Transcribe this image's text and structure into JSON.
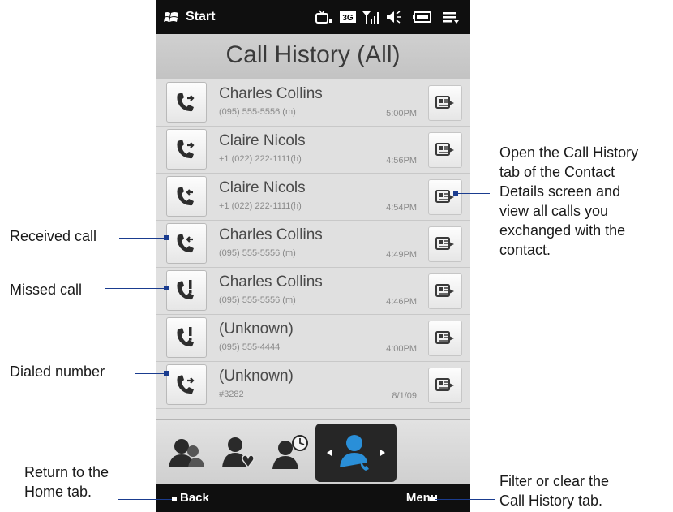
{
  "status_bar": {
    "start_label": "Start",
    "icons": [
      "tv-signal-icon",
      "3g-icon",
      "signal-strength-icon",
      "speaker-icon",
      "battery-icon",
      "connection-icon"
    ]
  },
  "header": {
    "title": "Call History (All)"
  },
  "calls": [
    {
      "name": "Charles Collins",
      "number": "(095) 555-5556 (m)",
      "time": "5:00PM",
      "type": "dialed"
    },
    {
      "name": "Claire Nicols",
      "number": "+1 (022) 222-1111(h)",
      "time": "4:56PM",
      "type": "dialed"
    },
    {
      "name": "Claire Nicols",
      "number": "+1 (022) 222-1111(h)",
      "time": "4:54PM",
      "type": "received"
    },
    {
      "name": "Charles Collins",
      "number": "(095) 555-5556 (m)",
      "time": "4:49PM",
      "type": "received"
    },
    {
      "name": "Charles Collins",
      "number": "(095) 555-5556 (m)",
      "time": "4:46PM",
      "type": "missed"
    },
    {
      "name": "(Unknown)",
      "number": "(095) 555-4444",
      "time": "4:00PM",
      "type": "missed"
    },
    {
      "name": "(Unknown)",
      "number": "#3282",
      "time": "8/1/09",
      "type": "dialed"
    }
  ],
  "tabs": [
    "all-contacts-tab",
    "favorites-tab",
    "recent-tab",
    "call-history-tab"
  ],
  "softkeys": {
    "left": "Back",
    "right": "Menu"
  },
  "callouts": {
    "received": "Received call",
    "missed": "Missed call",
    "dialed": "Dialed number",
    "return_line1": "Return to the",
    "return_line2": "Home tab.",
    "open_lines": [
      "Open the Call History",
      "tab of the Contact",
      "Details screen and",
      "view all calls you",
      "exchanged with the",
      "contact."
    ],
    "filter_line1": "Filter or clear the",
    "filter_line2": "Call History tab."
  },
  "colors": {
    "status_bar": "#0f0f0f",
    "accent_blue": "#2a8fd8",
    "callout_line": "#1a3c8f"
  }
}
